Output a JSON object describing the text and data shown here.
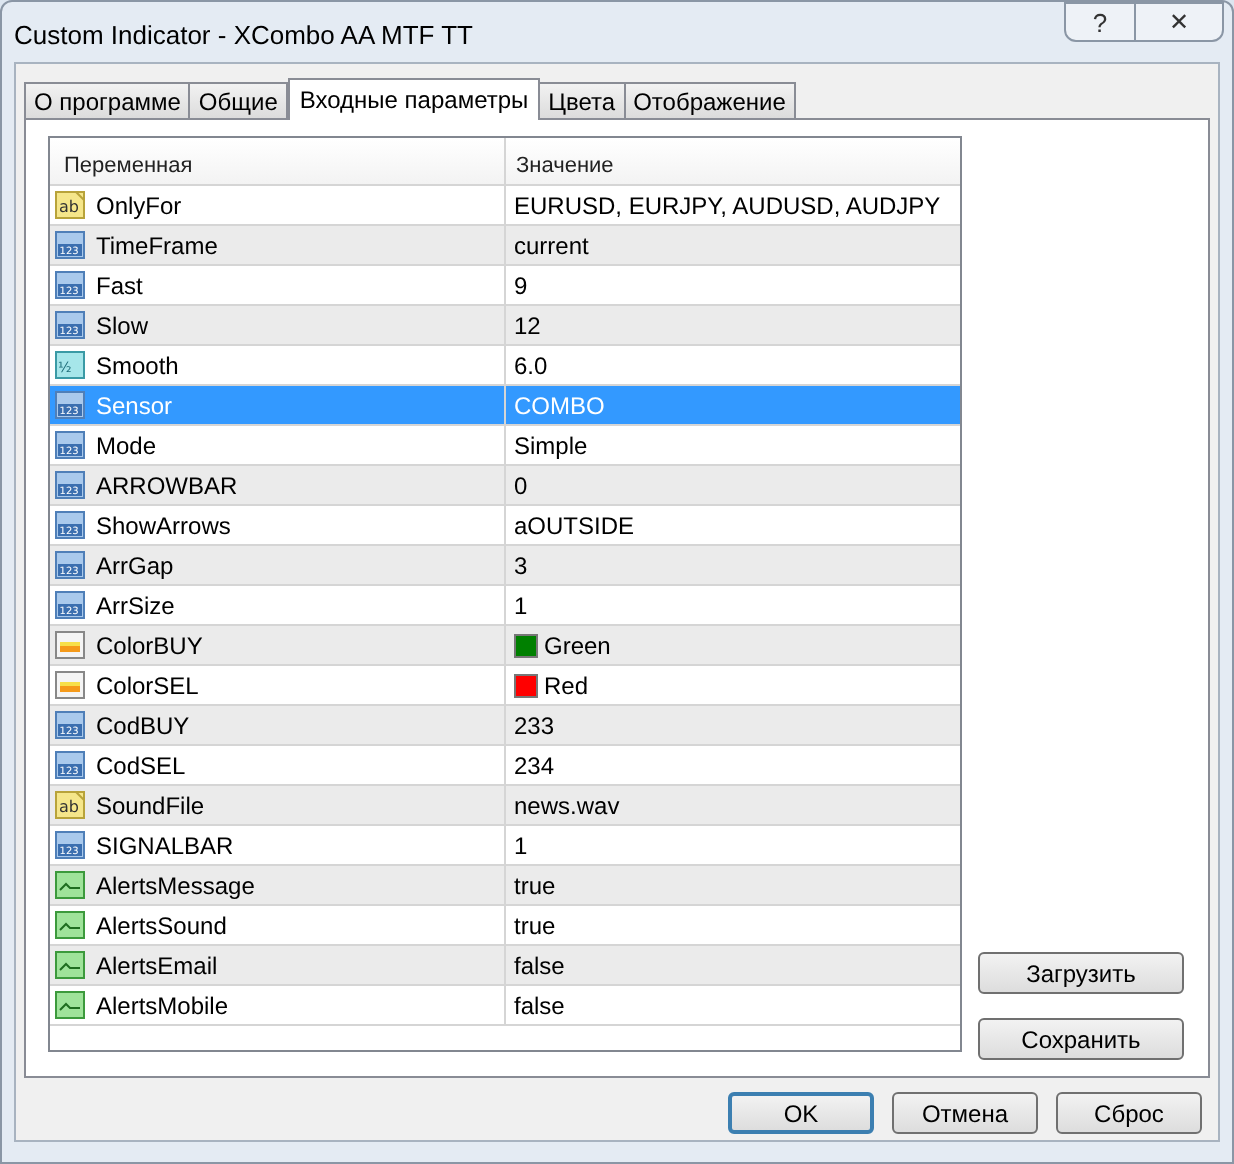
{
  "window": {
    "title": "Custom Indicator - XCombo AA MTF TT",
    "help_button": "?",
    "close_button": "✕"
  },
  "tabs": [
    {
      "label": "О программе",
      "selected": false
    },
    {
      "label": "Общие",
      "selected": false
    },
    {
      "label": "Входные параметры",
      "selected": true
    },
    {
      "label": "Цвета",
      "selected": false
    },
    {
      "label": "Отображение",
      "selected": false
    }
  ],
  "table": {
    "columns": [
      "Переменная",
      "Значение"
    ],
    "rows": [
      {
        "kind": "string",
        "icon_text": "ab",
        "name": "OnlyFor",
        "value": "EURUSD, EURJPY, AUDUSD, AUDJPY",
        "selected": false
      },
      {
        "kind": "int",
        "icon_text": "123",
        "name": "TimeFrame",
        "value": "current",
        "selected": false
      },
      {
        "kind": "int",
        "icon_text": "123",
        "name": "Fast",
        "value": "9",
        "selected": false
      },
      {
        "kind": "int",
        "icon_text": "123",
        "name": "Slow",
        "value": "12",
        "selected": false
      },
      {
        "kind": "double",
        "icon_text": "½",
        "name": "Smooth",
        "value": "6.0",
        "selected": false
      },
      {
        "kind": "int",
        "icon_text": "123",
        "name": "Sensor",
        "value": "COMBO",
        "selected": true
      },
      {
        "kind": "int",
        "icon_text": "123",
        "name": "Mode",
        "value": "Simple",
        "selected": false
      },
      {
        "kind": "int",
        "icon_text": "123",
        "name": "ARROWBAR",
        "value": "0",
        "selected": false
      },
      {
        "kind": "int",
        "icon_text": "123",
        "name": "ShowArrows",
        "value": "aOUTSIDE",
        "selected": false
      },
      {
        "kind": "int",
        "icon_text": "123",
        "name": "ArrGap",
        "value": "3",
        "selected": false
      },
      {
        "kind": "int",
        "icon_text": "123",
        "name": "ArrSize",
        "value": "1",
        "selected": false
      },
      {
        "kind": "color",
        "name": "ColorBUY",
        "value": "Green",
        "color": "#008000",
        "selected": false
      },
      {
        "kind": "color",
        "name": "ColorSEL",
        "value": "Red",
        "color": "#ff0000",
        "selected": false
      },
      {
        "kind": "int",
        "icon_text": "123",
        "name": "CodBUY",
        "value": "233",
        "selected": false
      },
      {
        "kind": "int",
        "icon_text": "123",
        "name": "CodSEL",
        "value": "234",
        "selected": false
      },
      {
        "kind": "string",
        "icon_text": "ab",
        "name": "SoundFile",
        "value": "news.wav",
        "selected": false
      },
      {
        "kind": "int",
        "icon_text": "123",
        "name": "SIGNALBAR",
        "value": "1",
        "selected": false
      },
      {
        "kind": "bool",
        "name": "AlertsMessage",
        "value": "true",
        "selected": false
      },
      {
        "kind": "bool",
        "name": "AlertsSound",
        "value": "true",
        "selected": false
      },
      {
        "kind": "bool",
        "name": "AlertsEmail",
        "value": "false",
        "selected": false
      },
      {
        "kind": "bool",
        "name": "AlertsMobile",
        "value": "false",
        "selected": false
      }
    ]
  },
  "side_buttons": [
    "Загрузить",
    "Сохранить"
  ],
  "buttons": [
    {
      "label": "OK",
      "default": true
    },
    {
      "label": "Отмена",
      "default": false
    },
    {
      "label": "Сброс",
      "default": false
    }
  ]
}
